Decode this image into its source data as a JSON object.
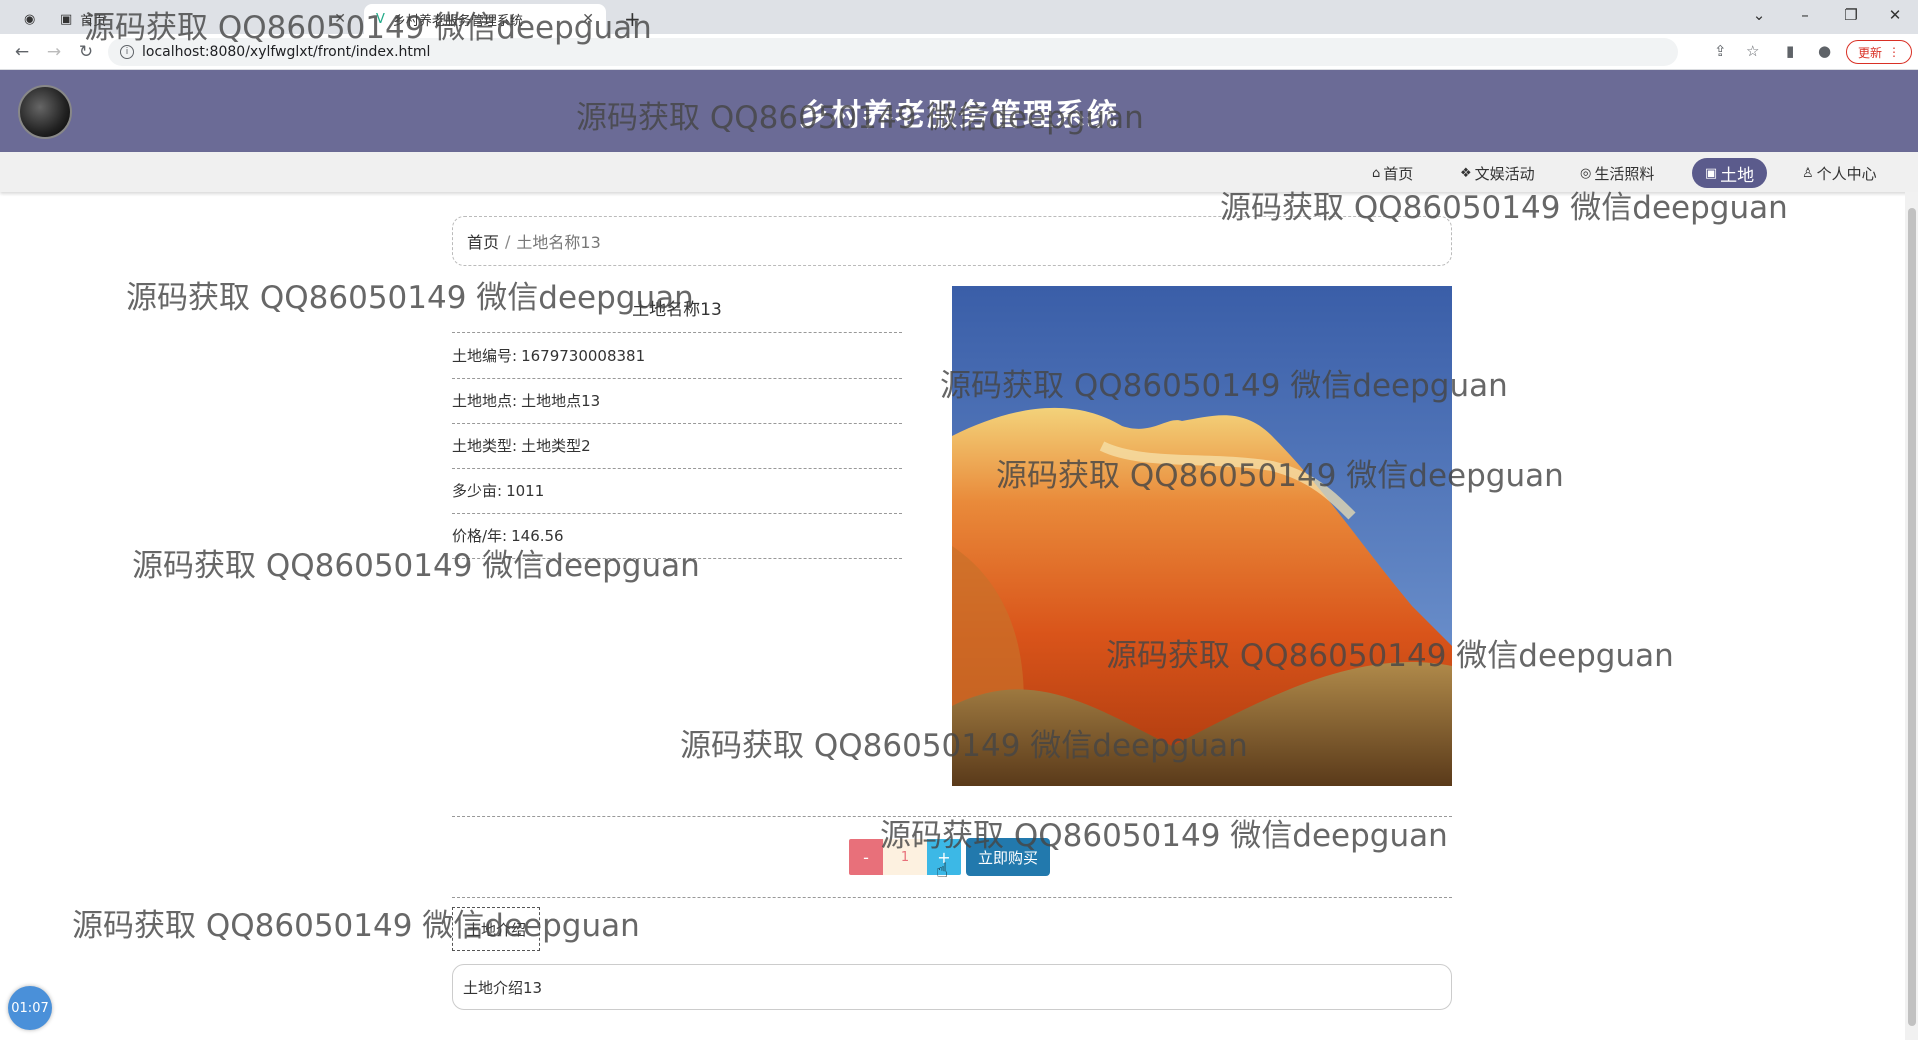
{
  "browser": {
    "tabs": [
      {
        "label": "首页",
        "active": false
      },
      {
        "label": "乡村养老服务管理系统",
        "active": true
      }
    ],
    "url": "localhost:8080/xylfwglxt/front/index.html",
    "update_label": "更新"
  },
  "header": {
    "title": "乡村养老服务管理系统"
  },
  "nav": {
    "items": [
      {
        "label": "首页",
        "icon": "home-icon",
        "glyph": "⌂",
        "active": false
      },
      {
        "label": "文娱活动",
        "icon": "layers-icon",
        "glyph": "❖",
        "active": false
      },
      {
        "label": "生活照料",
        "icon": "palette-icon",
        "glyph": "◎",
        "active": false
      },
      {
        "label": "土地",
        "icon": "gift-icon",
        "glyph": "▣",
        "active": true
      },
      {
        "label": "个人中心",
        "icon": "user-icon",
        "glyph": "♙",
        "active": false
      }
    ]
  },
  "breadcrumb": {
    "home": "首页",
    "separator": "/",
    "current": "土地名称13"
  },
  "detail": {
    "title": "土地名称13",
    "rows": [
      {
        "label": "土地编号:",
        "value": "1679730008381"
      },
      {
        "label": "土地地点:",
        "value": "土地地点13"
      },
      {
        "label": "土地类型:",
        "value": "土地类型2"
      },
      {
        "label": "多少亩:",
        "value": "1011"
      },
      {
        "label": "价格/年:",
        "value": "146.56"
      }
    ]
  },
  "purchase": {
    "minus": "-",
    "quantity": "1",
    "plus": "+",
    "buy_label": "立即购买"
  },
  "intro": {
    "tab_label": "土地介绍",
    "content": "土地介绍13"
  },
  "timer": "01:07",
  "watermark_text": "源码获取 QQ86050149 微信deepguan",
  "colors": {
    "header_bg": "#6b6b96",
    "nav_active": "#5b5b8c",
    "minus_btn": "#e8707a",
    "plus_btn": "#3cb8e6",
    "buy_btn": "#2279ad"
  }
}
